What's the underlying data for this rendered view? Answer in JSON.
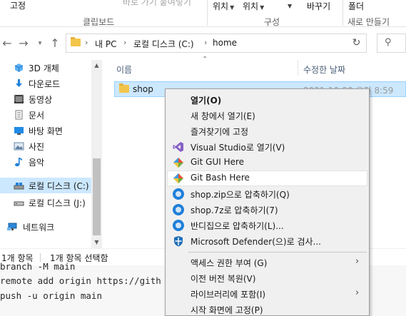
{
  "ribbon": {
    "items": {
      "paste_shortcut": "바로 가기 붙여넣기",
      "pin": "고정",
      "move_to": "위치",
      "copy_to": "위치",
      "rename": "바꾸기",
      "new_folder": "폴더"
    },
    "groups": {
      "clipboard": "클립보드",
      "organize": "구성",
      "new": "새로 만들기"
    }
  },
  "address_bar": {
    "crumbs": [
      "내 PC",
      "로컬 디스크 (C:)",
      "home"
    ]
  },
  "sidebar": {
    "items": [
      {
        "label": "3D 개체",
        "icon": "3d-objects-icon"
      },
      {
        "label": "다운로드",
        "icon": "download-icon"
      },
      {
        "label": "동영상",
        "icon": "video-icon"
      },
      {
        "label": "문서",
        "icon": "document-icon"
      },
      {
        "label": "바탕 화면",
        "icon": "desktop-icon"
      },
      {
        "label": "사진",
        "icon": "pictures-icon"
      },
      {
        "label": "음악",
        "icon": "music-icon"
      },
      {
        "label": "로컬 디스크 (C:)",
        "icon": "drive-icon"
      },
      {
        "label": "로컬 디스크 (J:)",
        "icon": "drive-icon"
      },
      {
        "label": "네트워크",
        "icon": "network-icon"
      }
    ]
  },
  "file_list": {
    "columns": {
      "name": "이름",
      "modified": "수정한 날짜"
    },
    "rows": [
      {
        "name": "shop",
        "modified": "2021-10-20 오전 8:59"
      }
    ]
  },
  "status_bar": {
    "count": "1개 항목",
    "selected": "1개 항목 선택함"
  },
  "terminal": {
    "lines": [
      "branch -M main",
      "remote add origin https://gith",
      "push -u origin main"
    ]
  },
  "context_menu": {
    "items": [
      {
        "label": "열기(O)",
        "bold": true
      },
      {
        "label": "새 창에서 열기(E)"
      },
      {
        "label": "즐겨찾기에 고정"
      },
      {
        "label": "Visual Studio로 열기(V)",
        "icon": "visual-studio-icon"
      },
      {
        "label": "Git GUI Here",
        "icon": "git-gui-icon"
      },
      {
        "label": "Git Bash Here",
        "icon": "git-bash-icon"
      },
      {
        "label": "shop.zip으로 압축하기(Q)",
        "icon": "bandizip-icon"
      },
      {
        "label": "shop.7z로 압축하기(7)",
        "icon": "bandizip-icon"
      },
      {
        "label": "반디집으로 압축하기(L)...",
        "icon": "bandizip-icon"
      },
      {
        "label": "Microsoft Defender(으)로 검사...",
        "icon": "defender-icon"
      },
      {
        "label": "액세스 권한 부여 (G)",
        "submenu": true
      },
      {
        "label": "이전 버전 복원(V)"
      },
      {
        "label": "라이브러리에 포함(I)",
        "submenu": true
      },
      {
        "label": "시작 화면에 고정(P)"
      }
    ]
  },
  "colors": {
    "selection": "#cce8ff",
    "folder": "#f3c54c",
    "accent": "#1f7fd9"
  }
}
